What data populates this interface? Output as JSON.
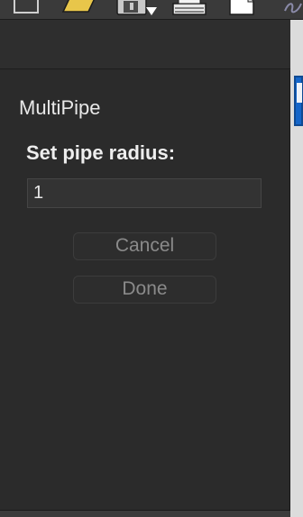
{
  "toolbar": {
    "icons": [
      "stop-icon",
      "folder-open-icon",
      "save-icon",
      "print-icon",
      "new-document-icon",
      "script-icon"
    ]
  },
  "dialog": {
    "title": "MultiPipe",
    "prompt": "Set pipe radius:",
    "radius_value": "1",
    "cancel_label": "Cancel",
    "done_label": "Done"
  },
  "colors": {
    "panel_bg": "#2b2b2b",
    "text": "#e8e8e8",
    "button_text_disabled": "#8a8a8a",
    "accent_blue": "#1566c9"
  }
}
